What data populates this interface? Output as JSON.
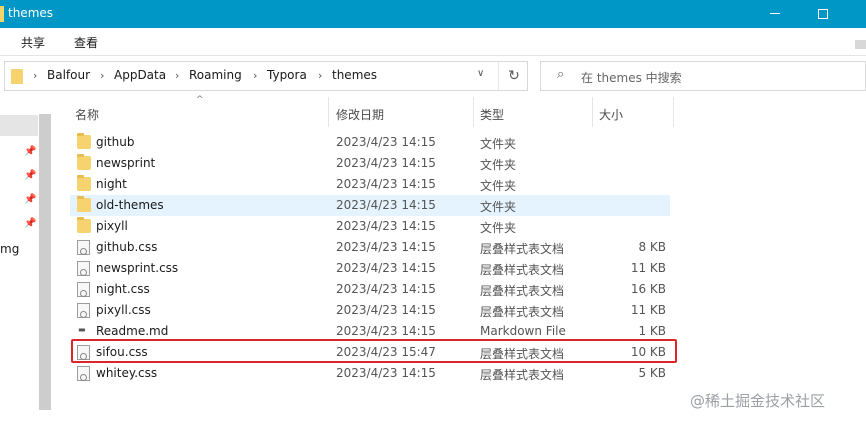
{
  "window": {
    "title": "themes"
  },
  "ribbon": {
    "tabs": [
      "共享",
      "查看"
    ]
  },
  "address": {
    "crumbs": [
      "Balfour",
      "AppData",
      "Roaming",
      "Typora",
      "themes"
    ],
    "separator": "›",
    "dropdown": "∨",
    "refresh": "↻"
  },
  "search": {
    "placeholder": "在 themes 中搜索",
    "icon": "search-icon"
  },
  "nav": {
    "partial_label": "mg",
    "pin_icon": "pin-icon"
  },
  "columns": {
    "name": "名称",
    "modified": "修改日期",
    "type": "类型",
    "size": "大小",
    "sort_arrow": "^"
  },
  "files": [
    {
      "name": "github",
      "date": "2023/4/23 14:15",
      "type": "文件夹",
      "size": "",
      "kind": "folder"
    },
    {
      "name": "newsprint",
      "date": "2023/4/23 14:15",
      "type": "文件夹",
      "size": "",
      "kind": "folder"
    },
    {
      "name": "night",
      "date": "2023/4/23 14:15",
      "type": "文件夹",
      "size": "",
      "kind": "folder"
    },
    {
      "name": "old-themes",
      "date": "2023/4/23 14:15",
      "type": "文件夹",
      "size": "",
      "kind": "folder",
      "hovered": true
    },
    {
      "name": "pixyll",
      "date": "2023/4/23 14:15",
      "type": "文件夹",
      "size": "",
      "kind": "folder"
    },
    {
      "name": "github.css",
      "date": "2023/4/23 14:15",
      "type": "层叠样式表文档",
      "size": "8 KB",
      "kind": "css"
    },
    {
      "name": "newsprint.css",
      "date": "2023/4/23 14:15",
      "type": "层叠样式表文档",
      "size": "11 KB",
      "kind": "css"
    },
    {
      "name": "night.css",
      "date": "2023/4/23 14:15",
      "type": "层叠样式表文档",
      "size": "16 KB",
      "kind": "css"
    },
    {
      "name": "pixyll.css",
      "date": "2023/4/23 14:15",
      "type": "层叠样式表文档",
      "size": "11 KB",
      "kind": "css"
    },
    {
      "name": "Readme.md",
      "date": "2023/4/23 14:15",
      "type": "Markdown File",
      "size": "1 KB",
      "kind": "md"
    },
    {
      "name": "sifou.css",
      "date": "2023/4/23 15:47",
      "type": "层叠样式表文档",
      "size": "10 KB",
      "kind": "css",
      "highlighted": true
    },
    {
      "name": "whitey.css",
      "date": "2023/4/23 14:15",
      "type": "层叠样式表文档",
      "size": "5 KB",
      "kind": "css"
    }
  ],
  "watermark": "@稀土掘金技术社区",
  "colors": {
    "titlebar": "#0097c7",
    "hover_row": "#e5f3ff",
    "highlight_border": "#d9262b",
    "folder": "#f6d36f"
  }
}
